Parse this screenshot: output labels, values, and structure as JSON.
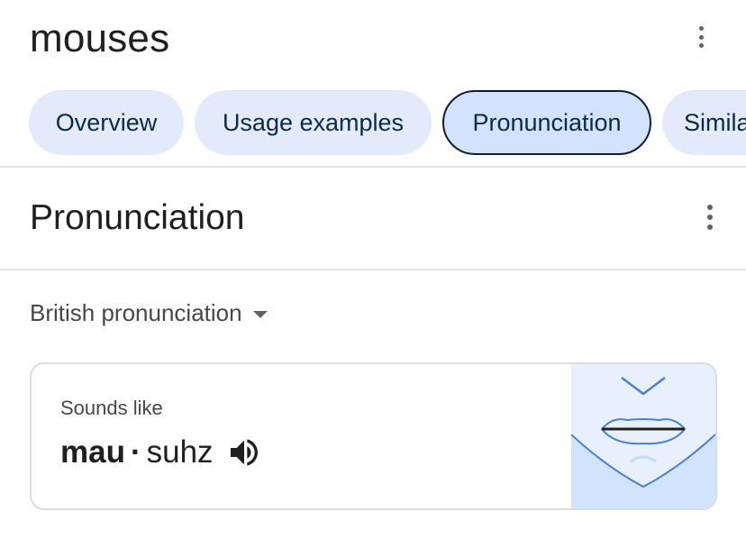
{
  "header": {
    "word": "mouses"
  },
  "tabs": [
    {
      "label": "Overview"
    },
    {
      "label": "Usage examples"
    },
    {
      "label": "Pronunciation"
    },
    {
      "label": "Simila"
    }
  ],
  "section": {
    "title": "Pronunciation",
    "dropdown_label": "British pronunciation"
  },
  "card": {
    "sounds_like": "Sounds like",
    "syllable_stressed": "mau",
    "separator": "·",
    "syllable_unstressed": "suhz"
  },
  "icons": {
    "more": "more-vert-icon",
    "dropdown": "arrow-drop-down-icon",
    "speaker": "volume-up-icon",
    "mouth": "mouth-diagram-icon"
  },
  "colors": {
    "chip_bg": "#e3ebfb",
    "chip_active_bg": "#d3e3fd",
    "chip_text": "#0b2948",
    "mouth_bg": "#e8f0fe",
    "mouth_lines": "#4a7fd4"
  }
}
